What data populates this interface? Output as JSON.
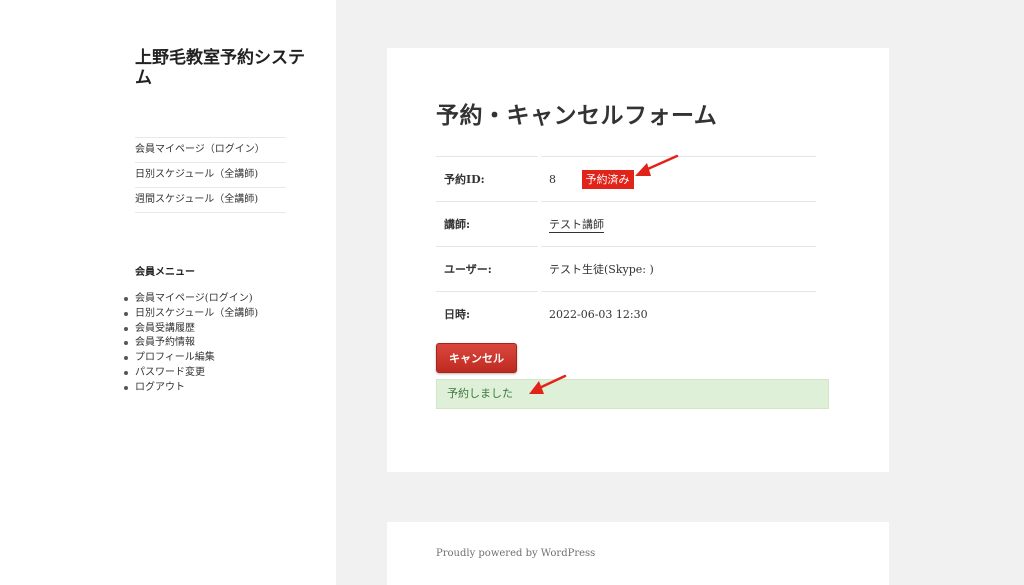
{
  "site": {
    "title": "上野毛教室予約システム"
  },
  "nav": {
    "items": [
      {
        "label": "会員マイページ（ログイン）"
      },
      {
        "label": "日別スケジュール（全講師)"
      },
      {
        "label": "週間スケジュール（全講師)"
      }
    ]
  },
  "widget": {
    "title": "会員メニュー",
    "items": [
      {
        "label": "会員マイページ(ログイン)"
      },
      {
        "label": "日別スケジュール（全講師)"
      },
      {
        "label": "会員受講履歴"
      },
      {
        "label": "会員予約情報"
      },
      {
        "label": "プロフィール編集"
      },
      {
        "label": "パスワード変更"
      },
      {
        "label": "ログアウト"
      }
    ]
  },
  "form": {
    "title": "予約・キャンセルフォーム",
    "rows": {
      "id": {
        "key": "予約ID:",
        "value": "8",
        "badge": "予約済み"
      },
      "teacher": {
        "key": "講師:",
        "value": "テスト講師"
      },
      "user": {
        "key": "ユーザー:",
        "value": "テスト生徒(Skype: )"
      },
      "datetime": {
        "key": "日時:",
        "value": "2022-06-03 12:30"
      }
    },
    "cancel_label": "キャンセル",
    "notice": "予約しました"
  },
  "footer": {
    "text": "Proudly powered by WordPress"
  },
  "colors": {
    "accent_red": "#e2231a",
    "notice_bg": "#dff0d8",
    "page_bg": "#f1f1f1"
  }
}
